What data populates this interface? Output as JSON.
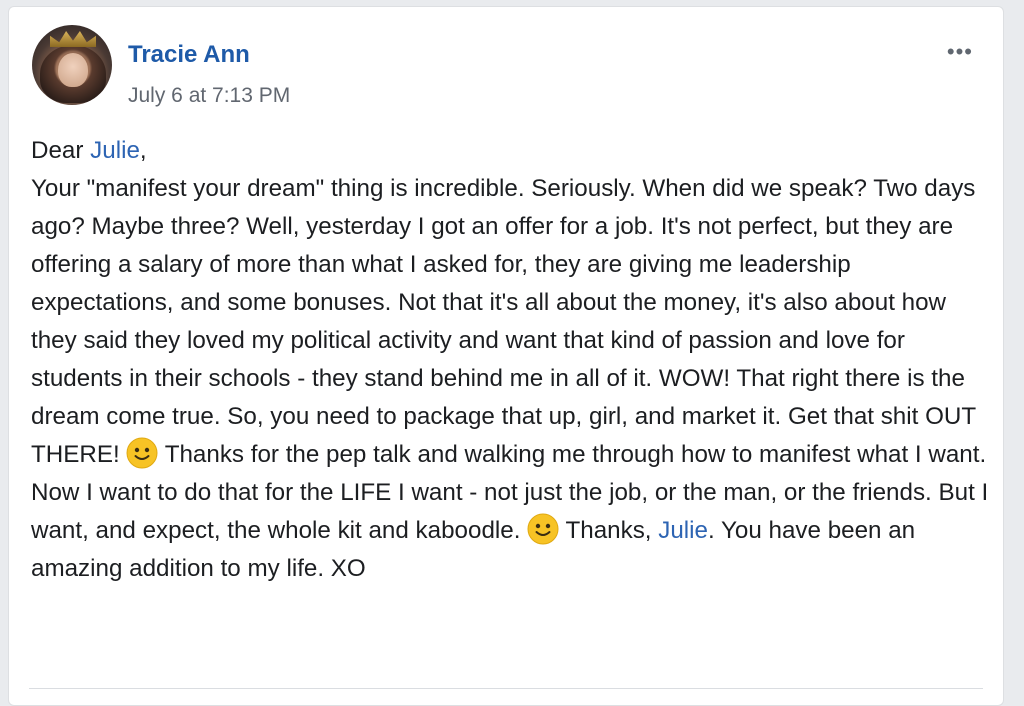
{
  "post": {
    "author": "Tracie Ann",
    "timestamp": "July 6 at 7:13 PM",
    "more_icon": "•••",
    "body": {
      "greeting_prefix": "Dear ",
      "mention_1": "Julie",
      "greeting_suffix": ",",
      "line_1": "Your \"manifest your dream\" thing is incredible. Seriously. When did we speak? Two days ago? Maybe three? Well, yesterday I got an offer for a job. It's not perfect, but they are offering a salary of more than what I asked for, they are giving me leadership expectations, and some bonuses. Not that it's all about the money, it's also about how they said they loved my political activity and want that kind of passion and love for students in their schools - they stand behind me in all of it. WOW! That right there is the dream come true. So, you need to package that up, girl, and market it. Get that shit OUT THERE! ",
      "line_2": " Thanks for the pep talk and walking me through how to manifest what I want. Now I want to do that for the LIFE I want - not just the job, or the man, or the friends. But I want, and expect, the whole kit and kaboodle. ",
      "line_3": " Thanks, ",
      "mention_2": "Julie",
      "line_4": ". You have been an amazing addition to my life. XO"
    }
  },
  "colors": {
    "author_link": "#1e5aa8",
    "mention": "#2d64b3",
    "emoji": "#f7c325"
  },
  "icons": {
    "emoji": "slightly-smiling-face-icon",
    "more": "ellipsis-icon"
  }
}
